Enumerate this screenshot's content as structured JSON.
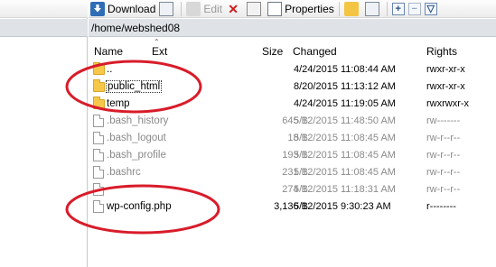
{
  "toolbar": {
    "download_label": "Download",
    "edit_label": "Edit",
    "properties_label": "Properties"
  },
  "path": "/home/webshed08",
  "columns": {
    "name": "Name",
    "ext": "Ext",
    "size": "Size",
    "changed": "Changed",
    "rights": "Rights"
  },
  "files": [
    {
      "name": "..",
      "size": "",
      "changed": "4/24/2015 11:08:44 AM",
      "rights": "rwxr-xr-x",
      "type": "folder",
      "hidden": false
    },
    {
      "name": "public_html",
      "size": "",
      "changed": "8/20/2015 11:13:12 AM",
      "rights": "rwxr-xr-x",
      "type": "folder",
      "hidden": false
    },
    {
      "name": "temp",
      "size": "",
      "changed": "4/24/2015 11:19:05 AM",
      "rights": "rwxrwxr-x",
      "type": "folder",
      "hidden": false
    },
    {
      "name": ".bash_history",
      "size": "645 B",
      "changed": "5/12/2015 11:48:50 AM",
      "rights": "rw-------",
      "type": "file",
      "hidden": true
    },
    {
      "name": ".bash_logout",
      "size": "18 B",
      "changed": "5/12/2015 11:08:45 AM",
      "rights": "rw-r--r--",
      "type": "file",
      "hidden": true
    },
    {
      "name": ".bash_profile",
      "size": "193 B",
      "changed": "5/12/2015 11:08:45 AM",
      "rights": "rw-r--r--",
      "type": "file",
      "hidden": true
    },
    {
      "name": ".bashrc",
      "size": "231 B",
      "changed": "5/12/2015 11:08:45 AM",
      "rights": "rw-r--r--",
      "type": "file",
      "hidden": true
    },
    {
      "name": "",
      "size": "274 B",
      "changed": "5/12/2015 11:18:31 AM",
      "rights": "rw-r--r--",
      "type": "file",
      "hidden": true
    },
    {
      "name": "wp-config.php",
      "size": "3,136 B",
      "changed": "5/12/2015 9:30:23 AM",
      "rights": "r--------",
      "type": "file",
      "hidden": false
    }
  ],
  "colors": {
    "annotation": "#d81c2a",
    "pathbar": "#dfe3e8",
    "folder": "#f5c84a"
  }
}
